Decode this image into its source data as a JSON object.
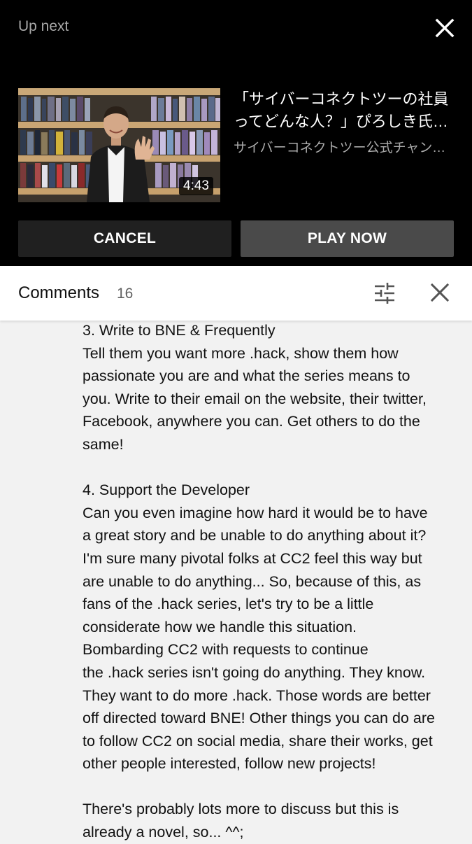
{
  "up_next": {
    "label": "Up next",
    "video": {
      "title": "「サイバーコネクトツーの社員ってどんな人？」ぴろしき氏の巻",
      "channel": "サイバーコネクトツー公式チャンネル",
      "duration": "4:43"
    },
    "cancel_label": "CANCEL",
    "play_label": "PLAY NOW",
    "icons": {
      "close": "close-icon"
    }
  },
  "comments": {
    "title": "Comments",
    "count": "16",
    "icons": {
      "sort": "sort-icon",
      "close": "close-icon"
    }
  },
  "comment": {
    "lines": [
      "3. Write to BNE & Frequently",
      "Tell them you want more .hack, show them how",
      "passionate you are and what the series means to",
      "you. Write to their email on the website, their twitter,",
      "Facebook, anywhere you can. Get others to do the",
      "same!",
      "",
      "4. Support the Developer",
      "Can you even imagine how hard it would be to have",
      "a great story and be unable to do anything about it?",
      "I'm sure many pivotal folks at CC2 feel this way but",
      "are unable to do anything... So, because of this, as",
      "fans of the .hack series, let's try to be a little",
      "considerate how we handle this situation.",
      "Bombarding CC2 with requests to continue",
      "the .hack series isn't going do anything. They know.",
      "They want to do more .hack. Those words are better",
      "off directed toward BNE! Other things you can do are",
      "to follow CC2 on social media, share their works, get",
      "other people interested, follow new projects!",
      "",
      "There's probably lots more to discuss but this is",
      "already a novel, so... ^^;"
    ]
  }
}
